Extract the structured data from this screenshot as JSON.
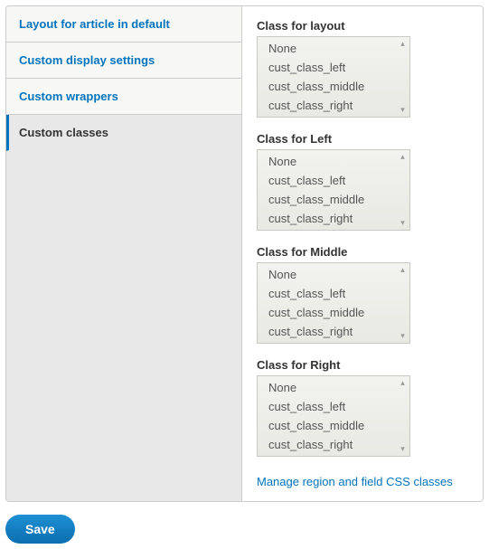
{
  "tabs": [
    {
      "label": "Layout for article in default"
    },
    {
      "label": "Custom display settings"
    },
    {
      "label": "Custom wrappers"
    },
    {
      "label": "Custom classes"
    }
  ],
  "fields": [
    {
      "label": "Class for layout",
      "options": [
        "None",
        "cust_class_left",
        "cust_class_middle",
        "cust_class_right"
      ]
    },
    {
      "label": "Class for Left",
      "options": [
        "None",
        "cust_class_left",
        "cust_class_middle",
        "cust_class_right"
      ]
    },
    {
      "label": "Class for Middle",
      "options": [
        "None",
        "cust_class_left",
        "cust_class_middle",
        "cust_class_right"
      ]
    },
    {
      "label": "Class for Right",
      "options": [
        "None",
        "cust_class_left",
        "cust_class_middle",
        "cust_class_right"
      ]
    }
  ],
  "manage_link": "Manage region and field CSS classes",
  "save_label": "Save"
}
